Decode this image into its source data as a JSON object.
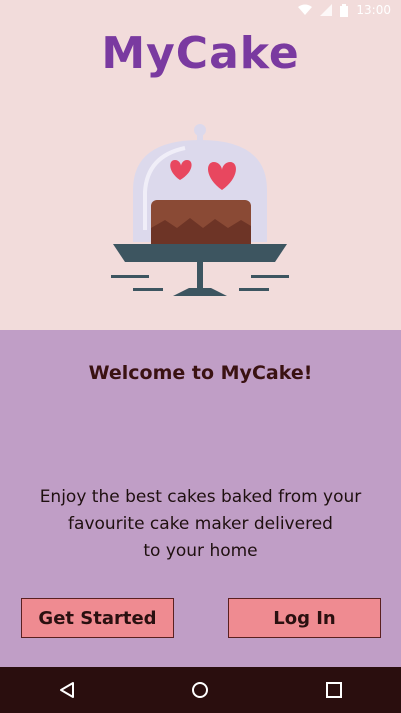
{
  "status_bar": {
    "time": "13:00"
  },
  "app": {
    "logo_text": "MyCake"
  },
  "welcome": {
    "title": "Welcome to MyCake!",
    "tagline_lines": [
      "Enjoy the best cakes baked from your",
      "favourite cake maker delivered",
      "to your home"
    ]
  },
  "buttons": {
    "get_started": "Get Started",
    "log_in": "Log In"
  },
  "nav": {
    "back_icon": "back-triangle-icon",
    "home_icon": "home-circle-icon",
    "recents_icon": "recents-square-icon"
  },
  "colors": {
    "top_background": "#f2dcdb",
    "bottom_background": "#c09ec6",
    "logo_purple": "#7a3aa0",
    "button_pink": "#ef8b91",
    "nav_bar": "#2a0e0e"
  }
}
